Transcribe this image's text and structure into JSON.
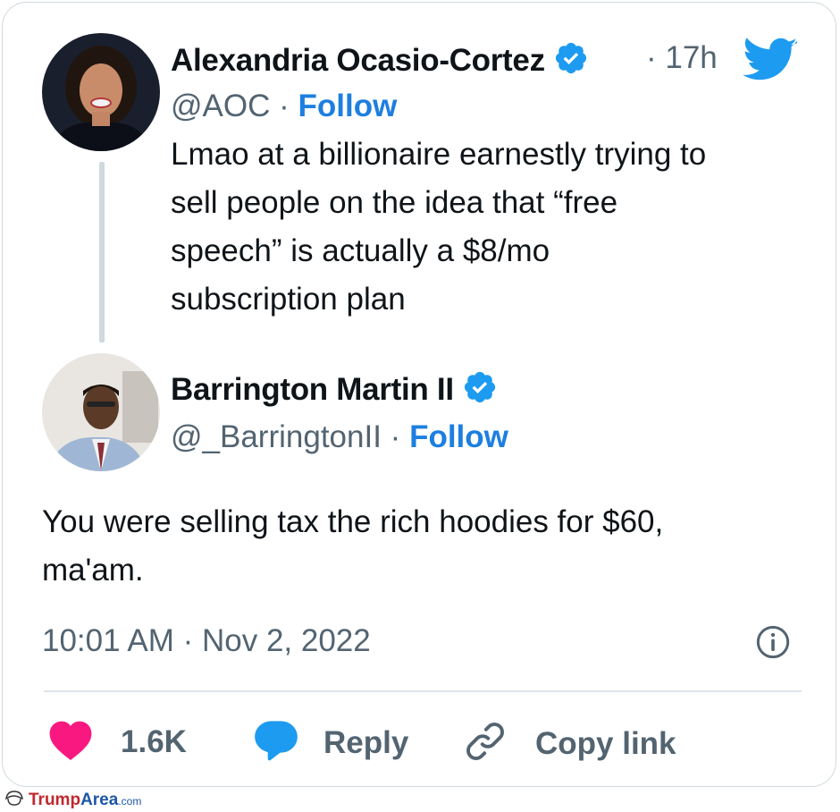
{
  "original_tweet": {
    "author_name": "Alexandria Ocasio-Cortez",
    "time_ago": "· 17h",
    "handle": "@AOC",
    "separator": "·",
    "follow_label": "Follow",
    "text_lines": [
      "Lmao at a billionaire earnestly trying to",
      "sell people on the idea that “free",
      "speech” is actually a $8/mo",
      "subscription plan"
    ]
  },
  "reply_tweet": {
    "author_name": "Barrington Martin II",
    "handle": "@_BarringtonII",
    "separator": "·",
    "follow_label": "Follow",
    "text_lines": [
      "You were selling tax the rich hoodies for $60,",
      "ma'am."
    ],
    "timestamp": "10:01 AM · Nov 2, 2022"
  },
  "actions": {
    "likes_count": "1.6K",
    "reply_label": "Reply",
    "copy_link_label": "Copy link"
  },
  "watermark": {
    "part1": "Trump",
    "part2": "Area",
    "part3": ".com"
  },
  "colors": {
    "follow_blue": "#1d7fe0",
    "twitter_blue": "#1d9bf0",
    "like_pink": "#f91880",
    "muted_gray": "#536471"
  },
  "icons": [
    "twitter-bird-icon",
    "verified-badge-icon",
    "info-icon",
    "heart-icon",
    "reply-bubble-icon",
    "link-icon"
  ]
}
